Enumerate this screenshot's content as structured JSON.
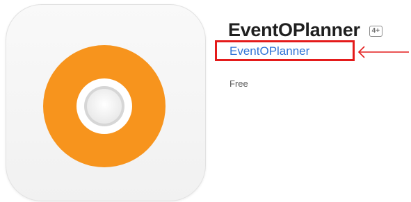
{
  "app": {
    "title": "EventOPlanner",
    "age_rating": "4+",
    "developer": "EventOPlanner",
    "price": "Free"
  },
  "icon": {
    "name": "disc-logo-icon",
    "ring_color": "#F7941D",
    "inner_color": "#FFFFFF",
    "background_color": "#F5F5F5"
  },
  "annotation": {
    "box_color": "#E41B1B",
    "arrow_color": "#E41B1B"
  }
}
